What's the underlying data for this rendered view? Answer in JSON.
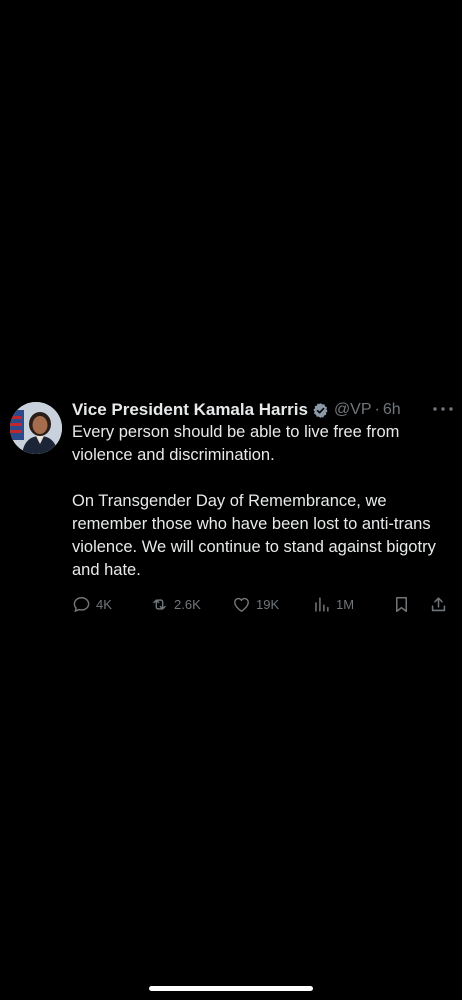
{
  "tweet": {
    "author": {
      "display_name": "Vice President Kamala Harris",
      "handle": "@VP",
      "separator": "·",
      "time": "6h",
      "verified_icon": "verified-badge-icon",
      "verified_color": "#8b98a5"
    },
    "text": [
      "Every person should be able to live free from violence and discrimination.",
      "On Transgender Day of Remembrance, we remember those who have been lost to anti-trans violence. We will continue to stand against bigotry and hate."
    ],
    "stats": {
      "replies": "4K",
      "retweets": "2.6K",
      "likes": "19K",
      "views": "1M"
    },
    "icons": {
      "reply": "reply-icon",
      "retweet": "retweet-icon",
      "like": "like-icon",
      "views": "views-icon",
      "bookmark": "bookmark-icon",
      "share": "share-icon",
      "more": "more-icon"
    }
  },
  "colors": {
    "background": "#000000",
    "primary_text": "#e7e9ea",
    "secondary_text": "#71767b"
  }
}
